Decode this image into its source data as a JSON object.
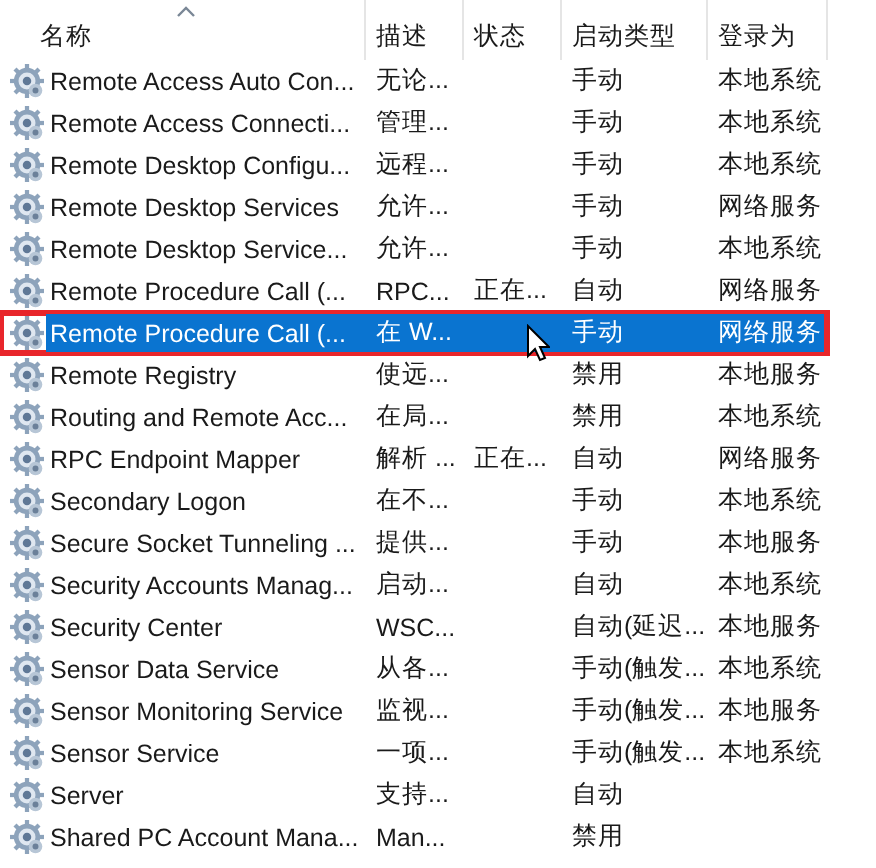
{
  "columns": [
    {
      "label": "名称",
      "sorted": true
    },
    {
      "label": "描述",
      "sorted": false
    },
    {
      "label": "状态",
      "sorted": false
    },
    {
      "label": "启动类型",
      "sorted": false
    },
    {
      "label": "登录为",
      "sorted": false
    }
  ],
  "rows": [
    {
      "name": "Remote Access Auto Con...",
      "description": "无论...",
      "status": "",
      "startup": "手动",
      "logon": "本地系统",
      "selected": false,
      "outlined": false
    },
    {
      "name": "Remote Access Connecti...",
      "description": "管理...",
      "status": "",
      "startup": "手动",
      "logon": "本地系统",
      "selected": false,
      "outlined": false
    },
    {
      "name": "Remote Desktop Configu...",
      "description": "远程...",
      "status": "",
      "startup": "手动",
      "logon": "本地系统",
      "selected": false,
      "outlined": false
    },
    {
      "name": "Remote Desktop Services",
      "description": "允许...",
      "status": "",
      "startup": "手动",
      "logon": "网络服务",
      "selected": false,
      "outlined": false
    },
    {
      "name": "Remote Desktop Service...",
      "description": "允许...",
      "status": "",
      "startup": "手动",
      "logon": "本地系统",
      "selected": false,
      "outlined": false
    },
    {
      "name": "Remote Procedure Call (...",
      "description": "RPC...",
      "status": "正在...",
      "startup": "自动",
      "logon": "网络服务",
      "selected": false,
      "outlined": false
    },
    {
      "name": "Remote Procedure Call (...",
      "description": "在 W...",
      "status": "",
      "startup": "手动",
      "logon": "网络服务",
      "selected": true,
      "outlined": true
    },
    {
      "name": "Remote Registry",
      "description": "使远...",
      "status": "",
      "startup": "禁用",
      "logon": "本地服务",
      "selected": false,
      "outlined": false
    },
    {
      "name": "Routing and Remote Acc...",
      "description": "在局...",
      "status": "",
      "startup": "禁用",
      "logon": "本地系统",
      "selected": false,
      "outlined": false
    },
    {
      "name": "RPC Endpoint Mapper",
      "description": "解析 ...",
      "status": "正在...",
      "startup": "自动",
      "logon": "网络服务",
      "selected": false,
      "outlined": false
    },
    {
      "name": "Secondary Logon",
      "description": "在不...",
      "status": "",
      "startup": "手动",
      "logon": "本地系统",
      "selected": false,
      "outlined": false
    },
    {
      "name": "Secure Socket Tunneling ...",
      "description": "提供...",
      "status": "",
      "startup": "手动",
      "logon": "本地服务",
      "selected": false,
      "outlined": false
    },
    {
      "name": "Security Accounts Manag...",
      "description": "启动...",
      "status": "",
      "startup": "自动",
      "logon": "本地系统",
      "selected": false,
      "outlined": false
    },
    {
      "name": "Security Center",
      "description": "WSC...",
      "status": "",
      "startup": "自动(延迟...",
      "logon": "本地服务",
      "selected": false,
      "outlined": false
    },
    {
      "name": "Sensor Data Service",
      "description": "从各...",
      "status": "",
      "startup": "手动(触发...",
      "logon": "本地系统",
      "selected": false,
      "outlined": false
    },
    {
      "name": "Sensor Monitoring Service",
      "description": "监视...",
      "status": "",
      "startup": "手动(触发...",
      "logon": "本地服务",
      "selected": false,
      "outlined": false
    },
    {
      "name": "Sensor Service",
      "description": "一项...",
      "status": "",
      "startup": "手动(触发...",
      "logon": "本地系统",
      "selected": false,
      "outlined": false
    },
    {
      "name": "Server",
      "description": "支持...",
      "status": "",
      "startup": "自动",
      "logon": "",
      "selected": false,
      "outlined": false
    },
    {
      "name": "Shared PC Account Mana...",
      "description": "Man...",
      "status": "",
      "startup": "禁用",
      "logon": "",
      "selected": false,
      "outlined": false
    }
  ]
}
